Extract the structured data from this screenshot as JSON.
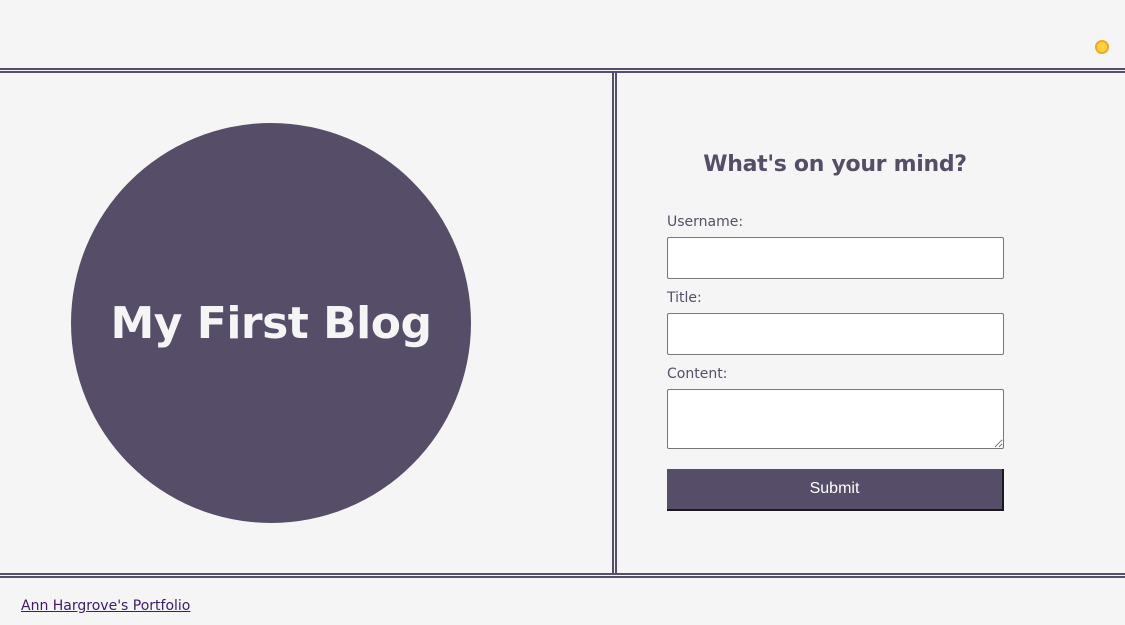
{
  "header": {
    "theme_toggle_icon": "sun-icon"
  },
  "hero": {
    "title": "My First Blog"
  },
  "form": {
    "heading": "What's on your mind?",
    "username_label": "Username:",
    "username_value": "",
    "title_label": "Title:",
    "title_value": "",
    "content_label": "Content:",
    "content_value": "",
    "submit_label": "Submit"
  },
  "footer": {
    "link_text": "Ann Hargrove's Portfolio"
  },
  "colors": {
    "primary": "#564e68",
    "background": "#f5f5f5",
    "sun": "#ffd23f"
  }
}
